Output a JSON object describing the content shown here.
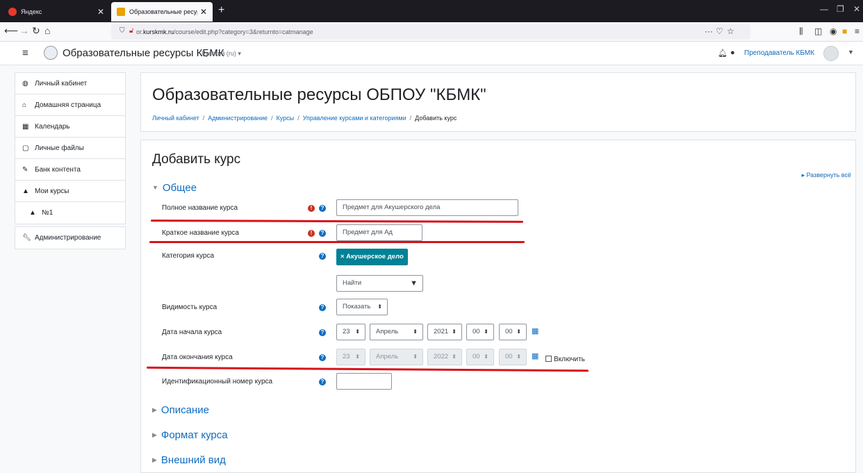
{
  "browser": {
    "tabs": [
      {
        "title": "Яндекс",
        "active": false
      },
      {
        "title": "Образовательные ресурсы КБ",
        "active": true
      }
    ],
    "url_prefix": "or.",
    "url_domain": "kurskmk.ru",
    "url_path": "/course/edit.php?category=3&returnto=catmanage"
  },
  "header": {
    "site_name": "Образовательные ресурсы КБМК",
    "language": "Русский (ru) ▾",
    "user_name": "Преподаватель КБМК"
  },
  "nav": {
    "items": [
      {
        "label": "Личный кабинет",
        "icon": "dashboard-icon"
      },
      {
        "label": "Домашняя страница",
        "icon": "home-icon"
      },
      {
        "label": "Календарь",
        "icon": "calendar-icon"
      },
      {
        "label": "Личные файлы",
        "icon": "file-icon"
      },
      {
        "label": "Банк контента",
        "icon": "paint-brush-icon"
      },
      {
        "label": "Мои курсы",
        "icon": "graduation-cap-icon"
      },
      {
        "label": "№1",
        "icon": "graduation-cap-icon"
      }
    ],
    "admin": {
      "label": "Администрирование",
      "icon": "wrench-icon"
    }
  },
  "page": {
    "title": "Образовательные ресурсы ОБПОУ \"КБМК\"",
    "breadcrumbs": [
      "Личный кабинет",
      "Администрирование",
      "Курсы",
      "Управление курсами и категориями"
    ],
    "breadcrumb_current": "Добавить курс"
  },
  "form": {
    "title": "Добавить курс",
    "expand_all": "Развернуть всё",
    "section_general": "Общее",
    "fullname_label": "Полное название курса",
    "fullname_value": "Предмет для Акушерского дела",
    "shortname_label": "Краткое название курса",
    "shortname_value": "Предмет для Ад",
    "category_label": "Категория курса",
    "category_tag": "× Акушерское дело",
    "category_search_placeholder": "Найти",
    "visibility_label": "Видимость курса",
    "visibility_value": "Показать",
    "startdate_label": "Дата начала курса",
    "startdate": {
      "day": "23",
      "month": "Апрель",
      "year": "2021",
      "hour": "00",
      "minute": "00"
    },
    "enddate_label": "Дата окончания курса",
    "enddate": {
      "day": "23",
      "month": "Апрель",
      "year": "2022",
      "hour": "00",
      "minute": "00"
    },
    "enable_label": "Включить",
    "idnumber_label": "Идентификационный номер курса",
    "idnumber_value": "",
    "section_description": "Описание",
    "section_format": "Формат курса",
    "section_appearance": "Внешний вид"
  },
  "colors": {
    "link": "#0f6cbf",
    "required": "#ca3120",
    "tag": "#008196",
    "annotation_underline": "#d8131a"
  }
}
